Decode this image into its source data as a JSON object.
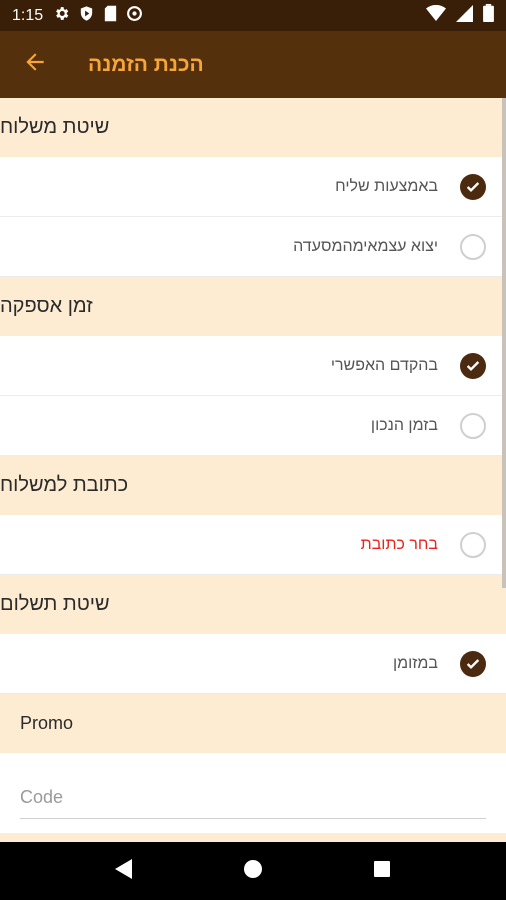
{
  "status": {
    "time": "1:15",
    "icons": [
      "gear-icon",
      "play-protect-icon",
      "sd-card-icon",
      "data-saver-icon",
      "wifi-icon",
      "signal-icon",
      "battery-icon"
    ]
  },
  "app_bar": {
    "title": "הכנת הזמנה",
    "title_color": "#f6a53a",
    "background": "#54300c"
  },
  "sections": [
    {
      "title": "שיטת משלוח",
      "options": [
        {
          "label": "באמצעות שליח",
          "checked": true
        },
        {
          "label": "יצוא עצמאימהמסעדה",
          "checked": false
        }
      ]
    },
    {
      "title": "זמן אספקה",
      "options": [
        {
          "label": "בהקדם האפשרי",
          "checked": true
        },
        {
          "label": "בזמן הנכון",
          "checked": false
        }
      ]
    },
    {
      "title": "כתובת למשלוח",
      "options": [
        {
          "label": "בחר כתובת",
          "checked": false,
          "color": "#e8241c"
        }
      ]
    },
    {
      "title": "שיטת תשלום",
      "options": [
        {
          "label": "במזומן",
          "checked": true
        }
      ]
    }
  ],
  "promo": {
    "title": "Promo",
    "placeholder": "Code",
    "value": ""
  },
  "colors": {
    "section_bg": "#fdebd2",
    "radio_checked": "#4b2a10",
    "accent": "#f6a53a"
  }
}
